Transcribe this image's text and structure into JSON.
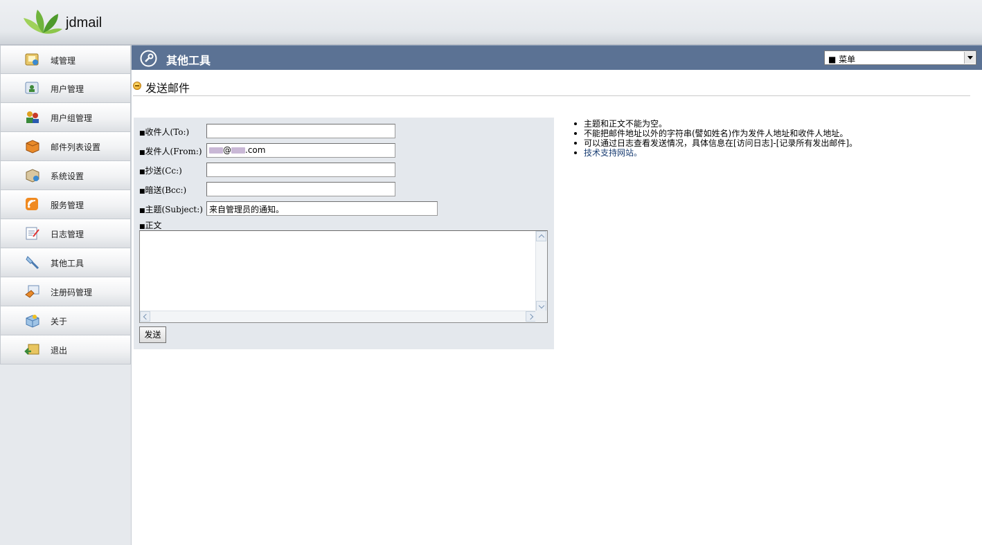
{
  "header": {
    "logo_text": "jdmail"
  },
  "sidebar": {
    "items": [
      {
        "label": "域管理",
        "icon": "domain-icon"
      },
      {
        "label": "用户管理",
        "icon": "users-icon"
      },
      {
        "label": "用户组管理",
        "icon": "user-group-icon"
      },
      {
        "label": "邮件列表设置",
        "icon": "mailing-list-icon"
      },
      {
        "label": "系统设置",
        "icon": "system-settings-icon"
      },
      {
        "label": "服务管理",
        "icon": "service-icon"
      },
      {
        "label": "日志管理",
        "icon": "log-icon"
      },
      {
        "label": "其他工具",
        "icon": "tools-icon"
      },
      {
        "label": "注册码管理",
        "icon": "license-icon"
      },
      {
        "label": "关于",
        "icon": "about-icon"
      },
      {
        "label": "退出",
        "icon": "logout-icon"
      }
    ]
  },
  "titlebar": {
    "title": "其他工具",
    "menu_value": "■ 菜单"
  },
  "section": {
    "title": "发送邮件"
  },
  "form": {
    "to_label": "收件人(To:)",
    "from_label": "发件人(From:)",
    "from_value_domain": "@",
    "from_value_tld": ".com",
    "cc_label": "抄送(Cc:)",
    "bcc_label": "暗送(Bcc:)",
    "subject_label": "主题(Subject:)",
    "subject_value": "来自管理员的通知。",
    "body_label": "正文",
    "send_label": "发送",
    "bullet": "■"
  },
  "notes": {
    "items": [
      "主题和正文不能为空。",
      "不能把邮件地址以外的字符串(譬如姓名)作为发件人地址和收件人地址。",
      "可以通过日志查看发送情况，具体信息在[访问日志]-[记录所有发出邮件]。"
    ],
    "link": "技术支持网站。"
  }
}
